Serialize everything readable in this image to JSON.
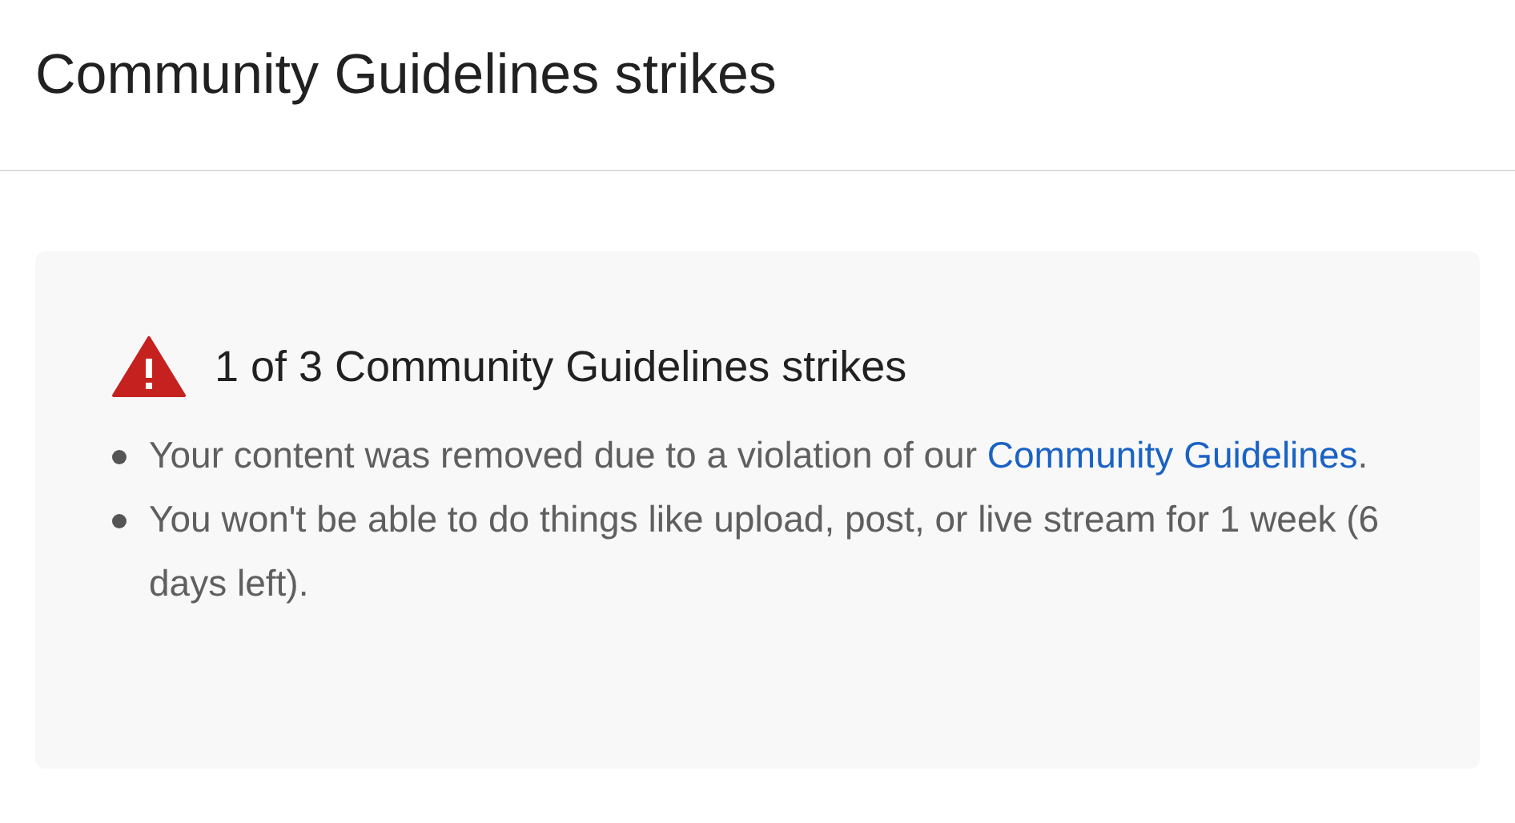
{
  "header": {
    "title": "Community Guidelines strikes"
  },
  "notice": {
    "title": "1 of 3 Community Guidelines strikes",
    "bullets": [
      {
        "text": "Your content was removed due to a violation of our",
        "link": "Community Guidelines",
        "after": "."
      },
      {
        "text": "You won't be able to do things like upload, post, or live stream for 1 week (6 days left)."
      }
    ]
  }
}
